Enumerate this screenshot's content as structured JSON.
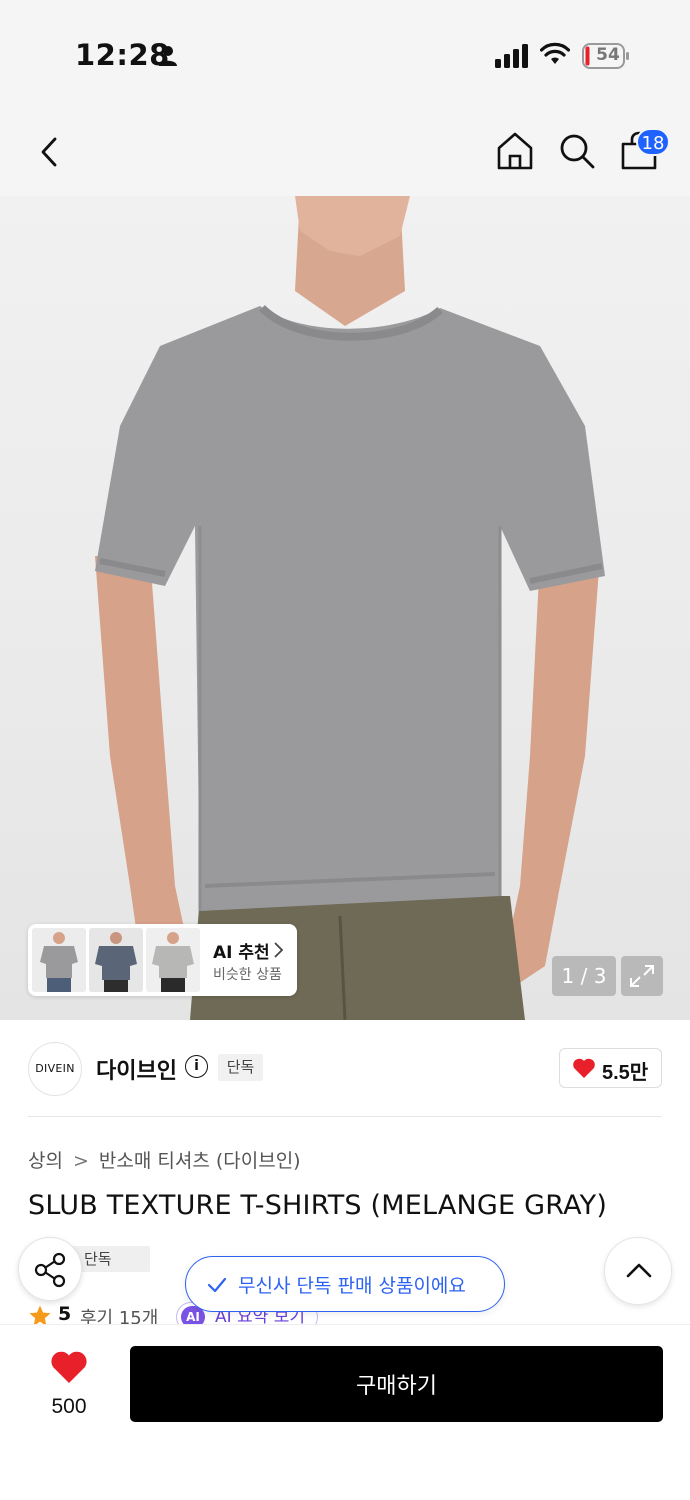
{
  "status_bar": {
    "time": "12:28",
    "battery": "54"
  },
  "header": {
    "cart_badge": "18"
  },
  "gallery": {
    "counter": "1 / 3",
    "ai_recommend_title": "AI 추천",
    "ai_recommend_subtitle": "비슷한 상품",
    "shirt_color": "#9a9a9c",
    "pants_color": "#6e6a56"
  },
  "brand": {
    "logo_text": "DIVEIN",
    "name": "다이브인",
    "info_icon": "i",
    "tag": "단독",
    "like_count": "5.5만"
  },
  "breadcrumb": {
    "level1": "상의",
    "separator": ">",
    "level2": "반소매 티셔츠 (다이브인)"
  },
  "product": {
    "title": "SLUB TEXTURE T-SHIRTS (MELANGE GRAY)",
    "tag": "단독",
    "rating": "5",
    "reviews": "후기 15개",
    "ai_summary_icon": "AI",
    "ai_summary": "AI 요약 보기"
  },
  "toast": {
    "text": "무신사 단독 판매 상품이에요"
  },
  "bottom_bar": {
    "wish_count": "500",
    "buy_label": "구매하기"
  },
  "colors": {
    "accent_blue": "#2e63f2",
    "heart_red": "#e8202a",
    "star_orange": "#f59a1b",
    "ai_purple": "#6a3fd8",
    "buy_button": "#000000"
  }
}
